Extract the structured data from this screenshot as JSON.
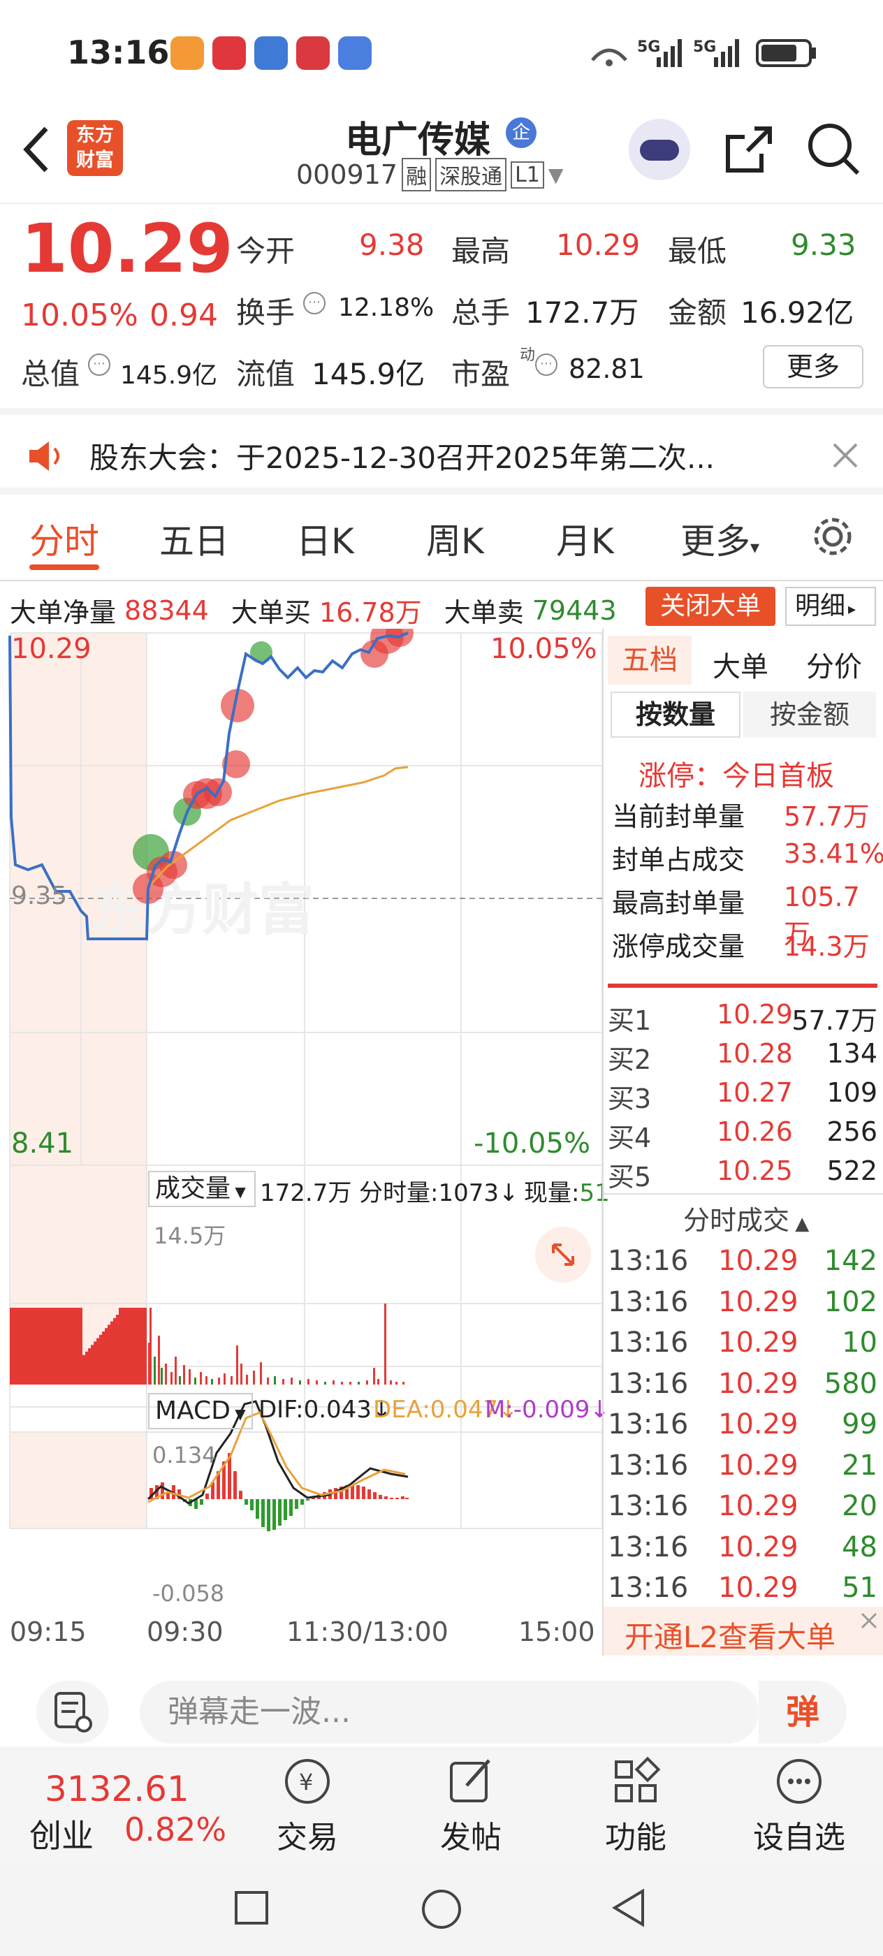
{
  "status": {
    "time": "13:16",
    "net1": "5G",
    "net2": "5G"
  },
  "header": {
    "logo_l1": "东方",
    "logo_l2": "财富",
    "name": "电广传媒",
    "badge": "企",
    "code": "000917",
    "tag1": "融",
    "tag2": "深股通",
    "tag3": "L1"
  },
  "quote": {
    "price": "10.29",
    "pct": "10.05%",
    "chg": "0.94",
    "open_l": "今开",
    "open_v": "9.38",
    "high_l": "最高",
    "high_v": "10.29",
    "low_l": "最低",
    "low_v": "9.33",
    "turn_l": "换手",
    "turn_v": "12.18%",
    "vol_l": "总手",
    "vol_v": "172.7万",
    "amt_l": "金额",
    "amt_v": "16.92亿",
    "mcap_l": "总值",
    "mcap_v": "145.9亿",
    "float_l": "流值",
    "float_v": "145.9亿",
    "pe_l": "市盈",
    "pe_sup": "动",
    "pe_v": "82.81",
    "more": "更多"
  },
  "notice": {
    "text": "股东大会：于2025-12-30召开2025年第二次..."
  },
  "tabs": [
    "分时",
    "五日",
    "日K",
    "周K",
    "月K",
    "更多"
  ],
  "bigorder": {
    "net_l": "大单净量",
    "net_v": "88344",
    "buy_l": "大单买",
    "buy_v": "16.78万",
    "sell_l": "大单卖",
    "sell_v": "79443",
    "close_btn": "关闭大单",
    "detail": "明细"
  },
  "chart": {
    "top_price": "10.29",
    "top_pct": "10.05%",
    "mid_price": "9.35",
    "bot_price": "8.41",
    "bot_pct": "-10.05%",
    "watermark": "东方财富",
    "vol_sel": "成交量",
    "vol_total": "172.7万",
    "vol_fs": "分时量:1073↓",
    "vol_now_l": "现量:",
    "vol_now_v": "51",
    "vol_max": "14.5万",
    "macd_sel": "MACD",
    "dif": "DIF:0.043↓",
    "dea": "DEA:0.047↓",
    "m": "M:-0.009↓",
    "macd_top": "0.134",
    "macd_bot": "-0.058",
    "t0": "09:15",
    "t1": "09:30",
    "t2": "11:30/13:00",
    "t3": "15:00"
  },
  "panel": {
    "tabs": [
      "五档",
      "大单",
      "分价"
    ],
    "sub": [
      "按数量",
      "按金额"
    ],
    "limit_title": "涨停：今日首板",
    "stats": [
      {
        "l": "当前封单量",
        "v": "57.7万"
      },
      {
        "l": "封单占成交",
        "v": "33.41%"
      },
      {
        "l": "最高封单量",
        "v": "105.7万"
      },
      {
        "l": "涨停成交量",
        "v": "14.3万"
      }
    ],
    "buys": [
      {
        "l": "买1",
        "p": "10.29",
        "q": "57.7万"
      },
      {
        "l": "买2",
        "p": "10.28",
        "q": "134"
      },
      {
        "l": "买3",
        "p": "10.27",
        "q": "109"
      },
      {
        "l": "买4",
        "p": "10.26",
        "q": "256"
      },
      {
        "l": "买5",
        "p": "10.25",
        "q": "522"
      }
    ],
    "ticks_title": "分时成交",
    "ticks": [
      {
        "t": "13:16",
        "p": "10.29",
        "q": "142"
      },
      {
        "t": "13:16",
        "p": "10.29",
        "q": "102"
      },
      {
        "t": "13:16",
        "p": "10.29",
        "q": "10"
      },
      {
        "t": "13:16",
        "p": "10.29",
        "q": "580"
      },
      {
        "t": "13:16",
        "p": "10.29",
        "q": "99"
      },
      {
        "t": "13:16",
        "p": "10.29",
        "q": "21"
      },
      {
        "t": "13:16",
        "p": "10.29",
        "q": "20"
      },
      {
        "t": "13:16",
        "p": "10.29",
        "q": "48"
      },
      {
        "t": "13:16",
        "p": "10.29",
        "q": "51"
      }
    ],
    "l2": "开通L2查看大单"
  },
  "comment": {
    "placeholder": "弹幕走一波...",
    "btn": "弹"
  },
  "bottom": {
    "idx_v": "3132.61",
    "idx_l": "创业",
    "idx_p": "0.82%",
    "trade": "交易",
    "post": "发帖",
    "func": "功能",
    "watch": "设自选"
  },
  "colors": {
    "up": "#e53935",
    "down": "#2e8b2e",
    "line": "#3b6fc4",
    "avg": "#e8a23a"
  }
}
